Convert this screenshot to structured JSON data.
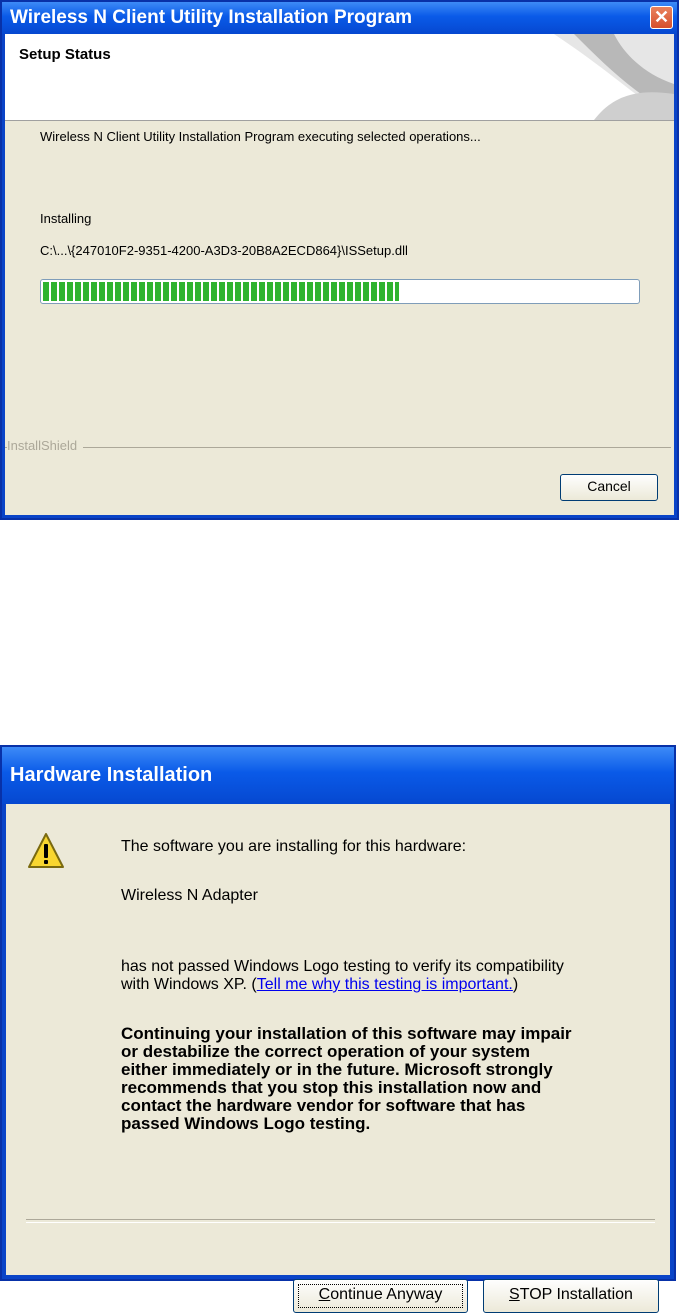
{
  "install_window": {
    "title": "Wireless N Client Utility Installation Program",
    "close_glyph": "✕",
    "header_title": "Setup Status",
    "status_line": "Wireless N Client Utility Installation Program executing selected operations...",
    "action_label": "Installing",
    "file_path": "C:\\...\\{247010F2-9351-4200-A3D3-20B8A2ECD864}\\ISSetup.dll",
    "progress_fraction": 0.6,
    "branding": "InstallShield",
    "cancel_label": "Cancel",
    "colors": {
      "title_bar": "#0a5ae8",
      "progress": "#2fb32f",
      "body": "#ece9d8"
    }
  },
  "hardware_dialog": {
    "title": "Hardware Installation",
    "icon": "warning-icon",
    "intro": "The software you are installing for this hardware:",
    "device_name": "Wireless N Adapter",
    "logo_test_line1": "has not passed Windows Logo testing to verify its compatibility",
    "logo_test_line2_prefix": "with Windows XP. (",
    "logo_test_link": "Tell me why this testing is important.",
    "logo_test_line2_suffix": ")",
    "warning_lines": [
      "Continuing your installation of this software may impair",
      "or destabilize the correct operation of your system",
      "either immediately or in the future. Microsoft strongly",
      "recommends that you stop this installation now and",
      "contact the hardware vendor for software that has",
      "passed Windows Logo testing."
    ],
    "continue_mnemonic": "C",
    "continue_rest": "ontinue Anyway",
    "stop_mnemonic": "S",
    "stop_rest": "TOP Installation"
  }
}
